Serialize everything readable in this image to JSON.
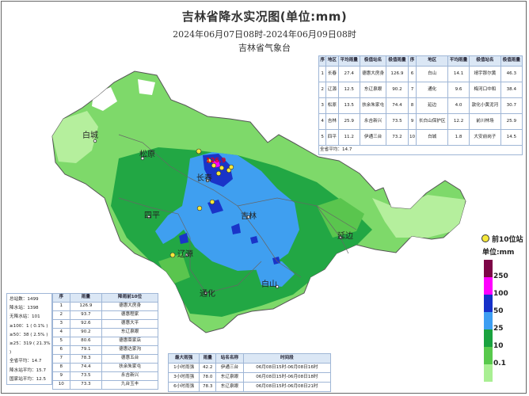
{
  "header": {
    "title": "吉林省降水实况图(单位:mm)",
    "subtitle": "2024年06月07日08时-2024年06月09日08时",
    "org": "吉林省气象台"
  },
  "map_labels": [
    "白城",
    "松原",
    "长春",
    "四平",
    "吉林",
    "辽源",
    "通化",
    "延边",
    "白山"
  ],
  "max_marker": "126.9",
  "region_table": {
    "headers": [
      "序",
      "地区",
      "平均雨量",
      "极值站名",
      "极值雨量",
      "序",
      "地区",
      "平均雨量",
      "极值站名",
      "极值雨量"
    ],
    "rows": [
      [
        "1",
        "长春",
        "27.4",
        "德惠大房身",
        "126.9",
        "6",
        "白山",
        "14.1",
        "靖宇那尔黄",
        "46.3"
      ],
      [
        "2",
        "辽源",
        "12.5",
        "东辽泉眼",
        "90.2",
        "7",
        "通化",
        "9.6",
        "梅河口中和",
        "38.4"
      ],
      [
        "3",
        "松原",
        "13.5",
        "扶余朱家屯",
        "74.4",
        "8",
        "延边",
        "4.0",
        "敦化小黄泥河",
        "30.7"
      ],
      [
        "4",
        "吉林",
        "25.9",
        "永吉新兴",
        "73.5",
        "9",
        "长白山保护区",
        "12.2",
        "前川林场",
        "25.9"
      ],
      [
        "5",
        "四平",
        "11.2",
        "伊通三台",
        "73.2",
        "10",
        "白城",
        "1.8",
        "大安前岗子",
        "14.5"
      ]
    ],
    "footer": "全省平均：14.7"
  },
  "stats": [
    "总站数：1499",
    "降水站：1398",
    "无降水站：101",
    "≥100：1 ( 0.1% )",
    "≥50：38 ( 2.5% )",
    "≥25：319 ( 21.3% )",
    "全省平均：14.7",
    "降水站平均：15.7",
    "国家站平均：12.5"
  ],
  "top10": {
    "headers": [
      "序",
      "雨量",
      "降雨前10位"
    ],
    "rows": [
      [
        "1",
        "126.9",
        "德惠大房身"
      ],
      [
        "2",
        "93.7",
        "德惠程家"
      ],
      [
        "3",
        "92.6",
        "德惠大平"
      ],
      [
        "4",
        "90.2",
        "东辽泉眼"
      ],
      [
        "5",
        "80.6",
        "德惠菜家店"
      ],
      [
        "6",
        "79.1",
        "德惠达家沟"
      ],
      [
        "7",
        "78.3",
        "德惠五台"
      ],
      [
        "8",
        "74.4",
        "扶余朱家屯"
      ],
      [
        "9",
        "73.5",
        "永吉新兴"
      ],
      [
        "10",
        "73.3",
        "九台玉丰"
      ]
    ]
  },
  "hourly": {
    "headers": [
      "最大雨强",
      "雨量",
      "站名名称",
      "时间段"
    ],
    "rows": [
      [
        "1小时雨强",
        "42.2",
        "伊通三台",
        "06月08日15时-06月08日16时"
      ],
      [
        "3小时雨强",
        "78.0",
        "东辽泉眼",
        "06月08日15时-06月08日18时"
      ],
      [
        "6小时雨强",
        "78.3",
        "东辽泉眼",
        "06月08日15时-06月08日21时"
      ]
    ]
  },
  "legend": {
    "station_label": "前10位站",
    "unit": "单位:mm",
    "ticks": [
      "250",
      "100",
      "50",
      "25",
      "10",
      "0.1"
    ],
    "colors": [
      "#7d0546",
      "#ff00ff",
      "#1530c9",
      "#3d9ef2",
      "#19a23f",
      "#58c94c",
      "#a9ef93"
    ]
  }
}
